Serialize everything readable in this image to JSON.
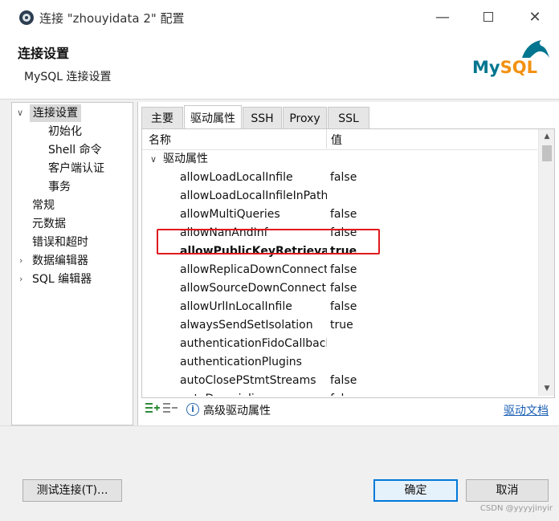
{
  "window": {
    "title": "连接 \"zhouyidata 2\" 配置",
    "min_glyph": "—",
    "close_glyph": "✕"
  },
  "header": {
    "title": "连接设置",
    "subtitle": "MySQL 连接设置",
    "logo_my": "My",
    "logo_sql": "SQL"
  },
  "nav": {
    "items": [
      {
        "label": "连接设置",
        "expanded": true,
        "selected": true
      },
      {
        "label": "初始化"
      },
      {
        "label": "Shell 命令"
      },
      {
        "label": "客户端认证"
      },
      {
        "label": "事务"
      },
      {
        "label": "常规"
      },
      {
        "label": "元数据"
      },
      {
        "label": "错误和超时"
      },
      {
        "label": "数据编辑器",
        "expandable": true
      },
      {
        "label": "SQL 编辑器",
        "expandable": true
      }
    ]
  },
  "tabs": [
    {
      "label": "主要"
    },
    {
      "label": "驱动属性",
      "active": true
    },
    {
      "label": "SSH"
    },
    {
      "label": "Proxy"
    },
    {
      "label": "SSL"
    }
  ],
  "table": {
    "col_name": "名称",
    "col_value": "值",
    "group": "驱动属性",
    "rows": [
      {
        "name": "allowLoadLocalInfile",
        "value": "false"
      },
      {
        "name": "allowLoadLocalInfileInPath",
        "value": ""
      },
      {
        "name": "allowMultiQueries",
        "value": "false"
      },
      {
        "name": "allowNanAndInf",
        "value": "false"
      },
      {
        "name": "allowPublicKeyRetrieval",
        "value": "true",
        "bold": true
      },
      {
        "name": "allowReplicaDownConnections",
        "value": "false"
      },
      {
        "name": "allowSourceDownConnections",
        "value": "false"
      },
      {
        "name": "allowUrlInLocalInfile",
        "value": "false"
      },
      {
        "name": "alwaysSendSetIsolation",
        "value": "true"
      },
      {
        "name": "authenticationFidoCallback",
        "value": ""
      },
      {
        "name": "authenticationPlugins",
        "value": ""
      },
      {
        "name": "autoClosePStmtStreams",
        "value": "false"
      },
      {
        "name": "autoDeserialize",
        "value": "false"
      }
    ]
  },
  "toolbar": {
    "advanced_label": "高级驱动属性",
    "driver_doc_link": "驱动文档"
  },
  "footer": {
    "test_button": "测试连接(T)...",
    "ok_button": "确定",
    "cancel_button": "取消",
    "watermark": "CSDN @yyyyjinyir"
  },
  "colors": {
    "highlight": "#e0191d",
    "link": "#1a5fb4",
    "primary_border": "#0078d7"
  }
}
